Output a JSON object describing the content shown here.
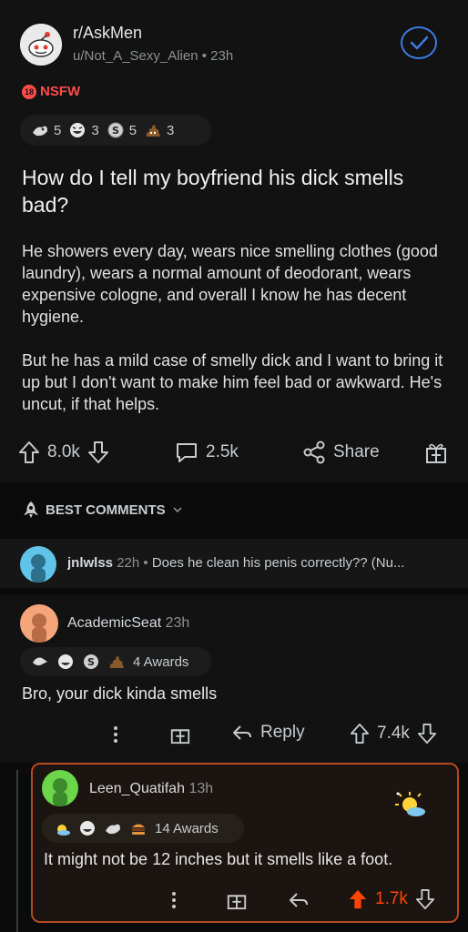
{
  "post": {
    "subreddit": "r/AskMen",
    "author_line": "u/Not_A_Sexy_Alien • 23h",
    "nsfw_label": "NSFW",
    "nsfw_badge": "18",
    "awards": [
      {
        "icon": "wholesome-seal-icon",
        "count": "5"
      },
      {
        "icon": "laughing-face-icon",
        "count": "3"
      },
      {
        "icon": "silver-coin-icon",
        "count": "5"
      },
      {
        "icon": "poop-icon",
        "count": "3"
      }
    ],
    "title": "How do I tell my boyfriend his dick smells bad?",
    "body": [
      "He showers every day, wears nice smelling clothes (good laundry), wears a normal amount of deodorant, wears expensive cologne, and overall I know he has decent hygiene.",
      "But he has a mild case of smelly dick and I want to bring it up but I don't want to make him feel bad or awkward. He's uncut, if that helps."
    ],
    "upvotes": "8.0k",
    "comments": "2.5k",
    "share_label": "Share"
  },
  "comments_section": {
    "sort_label": "BEST COMMENTS"
  },
  "collapsed_comment": {
    "author": "jnlwlss",
    "time": "22h",
    "preview": "Does he clean his penis correctly?? (Nu..."
  },
  "comment1": {
    "author": "AcademicSeat",
    "time": "23h",
    "awards_label": "4 Awards",
    "text": "Bro, your dick kinda smells",
    "reply_label": "Reply",
    "score": "7.4k"
  },
  "comment2": {
    "author": "Leen_Quatifah",
    "time": "13h",
    "awards_label": "14 Awards",
    "text": "It might not be 12 inches but it smells like a foot.",
    "score": "1.7k"
  },
  "colors": {
    "background": "#0b0b0b",
    "card": "#121212",
    "upvote_active": "#ff4500",
    "join_accent": "#3d7be3",
    "nsfw": "#ff4a4a",
    "highlight_border": "#b44a1f"
  }
}
